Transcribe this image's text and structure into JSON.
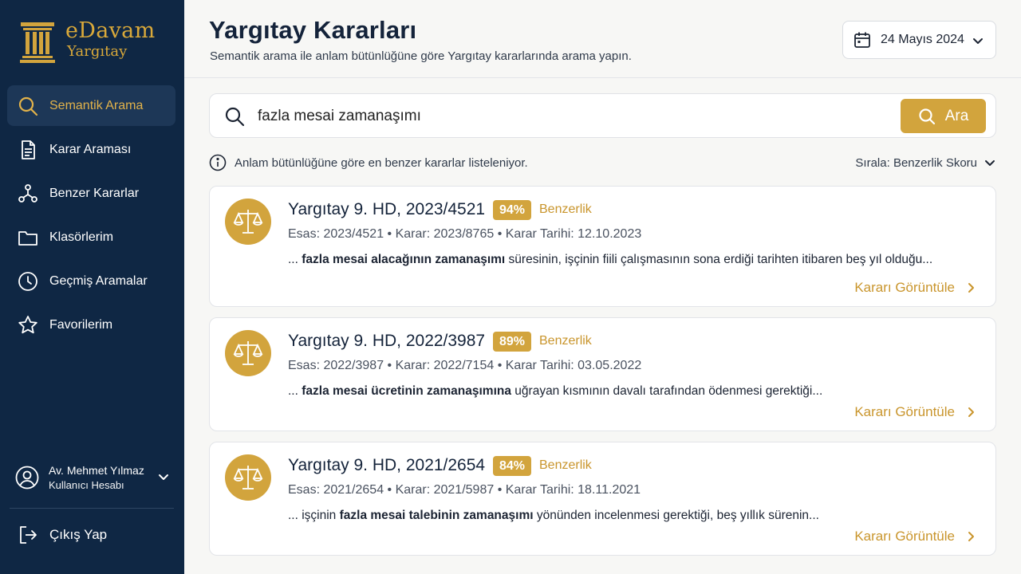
{
  "brand": {
    "name": "eDavam",
    "sub": "Yargıtay",
    "accent": "#d2a43d",
    "sidebar_bg": "#0f2744"
  },
  "sidebar": {
    "items": [
      {
        "label": "Semantik Arama",
        "icon": "search-icon",
        "active": true
      },
      {
        "label": "Karar Araması",
        "icon": "document-icon"
      },
      {
        "label": "Benzer Kararlar",
        "icon": "network-icon"
      },
      {
        "label": "Klasörlerim",
        "icon": "folder-icon"
      },
      {
        "label": "Geçmiş Aramalar",
        "icon": "clock-icon"
      },
      {
        "label": "Favorilerim",
        "icon": "star-icon"
      }
    ],
    "user": {
      "name": "Av. Mehmet Yılmaz",
      "role": "Kullanıcı Hesabı"
    },
    "logout": "Çıkış Yap"
  },
  "header": {
    "title": "Yargıtay Kararları",
    "subtitle": "Semantik arama ile anlam bütünlüğüne göre Yargıtay kararlarında arama yapın.",
    "date": "24 Mayıs 2024"
  },
  "search": {
    "value": "fazla mesai zamanaşımı",
    "button": "Ara"
  },
  "info": "Anlam bütünlüğüne göre en benzer kararlar listeleniyor.",
  "sort": {
    "label": "Sırala:",
    "value": "Benzerlik Skoru"
  },
  "results": [
    {
      "title": "Yargıtay 9. HD, 2023/4521",
      "score": "94%",
      "score_label": "Benzerlik",
      "esas": "Esas: 2023/4521",
      "karar": "Karar: 2023/8765",
      "tarih": "Karar Tarihi: 12.10.2023",
      "excerpt_pre": "... ",
      "excerpt_bold": "fazla mesai alacağının zamanaşımı",
      "excerpt_post": " süresinin, işçinin fiili çalışmasının sona erdiği tarihten itibaren beş yıl olduğu...",
      "link": "Kararı Görüntüle"
    },
    {
      "title": "Yargıtay 9. HD, 2022/3987",
      "score": "89%",
      "score_label": "Benzerlik",
      "esas": "Esas: 2022/3987",
      "karar": "Karar: 2022/7154",
      "tarih": "Karar Tarihi: 03.05.2022",
      "excerpt_pre": "... ",
      "excerpt_bold": "fazla mesai ücretinin zamanaşımına",
      "excerpt_post": " uğrayan kısmının davalı tarafından ödenmesi gerektiği...",
      "link": "Kararı Görüntüle"
    },
    {
      "title": "Yargıtay 9. HD, 2021/2654",
      "score": "84%",
      "score_label": "Benzerlik",
      "esas": "Esas: 2021/2654",
      "karar": "Karar: 2021/5987",
      "tarih": "Karar Tarihi: 18.11.2021",
      "excerpt_pre": "... işçinin ",
      "excerpt_bold": "fazla mesai talebinin zamanaşımı",
      "excerpt_post": " yönünden incelenmesi gerektiği, beş yıllık sürenin...",
      "link": "Kararı Görüntüle"
    }
  ]
}
